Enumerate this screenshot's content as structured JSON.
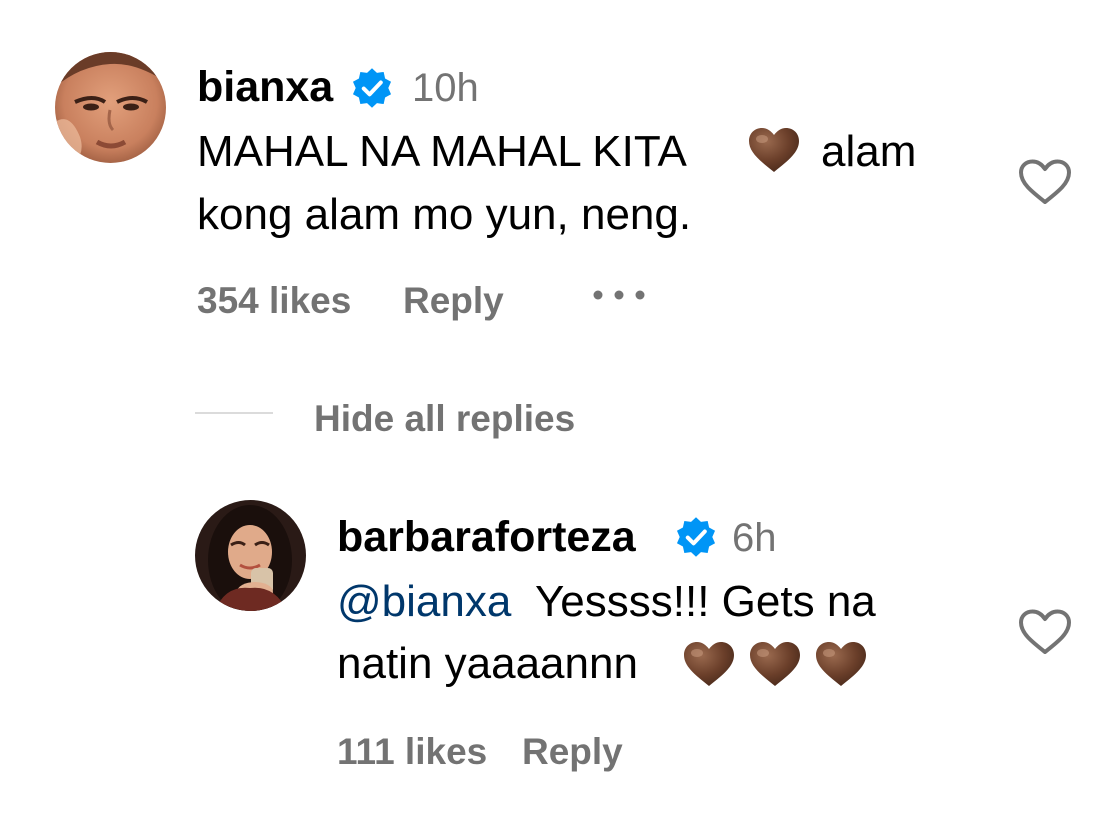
{
  "comment": {
    "username": "bianxa",
    "verified_icon": "verified-badge-icon",
    "time": "10h",
    "text_line1": "MAHAL NA MAHAL KITA",
    "text_line1_end": "alam",
    "text_line2": "kong alam mo yun, neng.",
    "likes": "354 likes",
    "reply_label": "Reply",
    "more_icon": "more-options-icon",
    "like_icon": "heart-outline-icon"
  },
  "replies_toggle": {
    "label": "Hide all replies"
  },
  "reply": {
    "username": "barbaraforteza",
    "verified_icon": "verified-badge-icon",
    "time": "6h",
    "mention": "@bianxa",
    "text_line1_rest": "Yessss!!! Gets na",
    "text_line2": "natin yaaaannn",
    "likes": "111 likes",
    "reply_label": "Reply",
    "like_icon": "heart-outline-icon"
  },
  "colors": {
    "text": "#000000",
    "secondary": "#737373",
    "mention": "#00376b",
    "verified": "#0095f6",
    "emoji_heart": "#6b3f2a"
  }
}
